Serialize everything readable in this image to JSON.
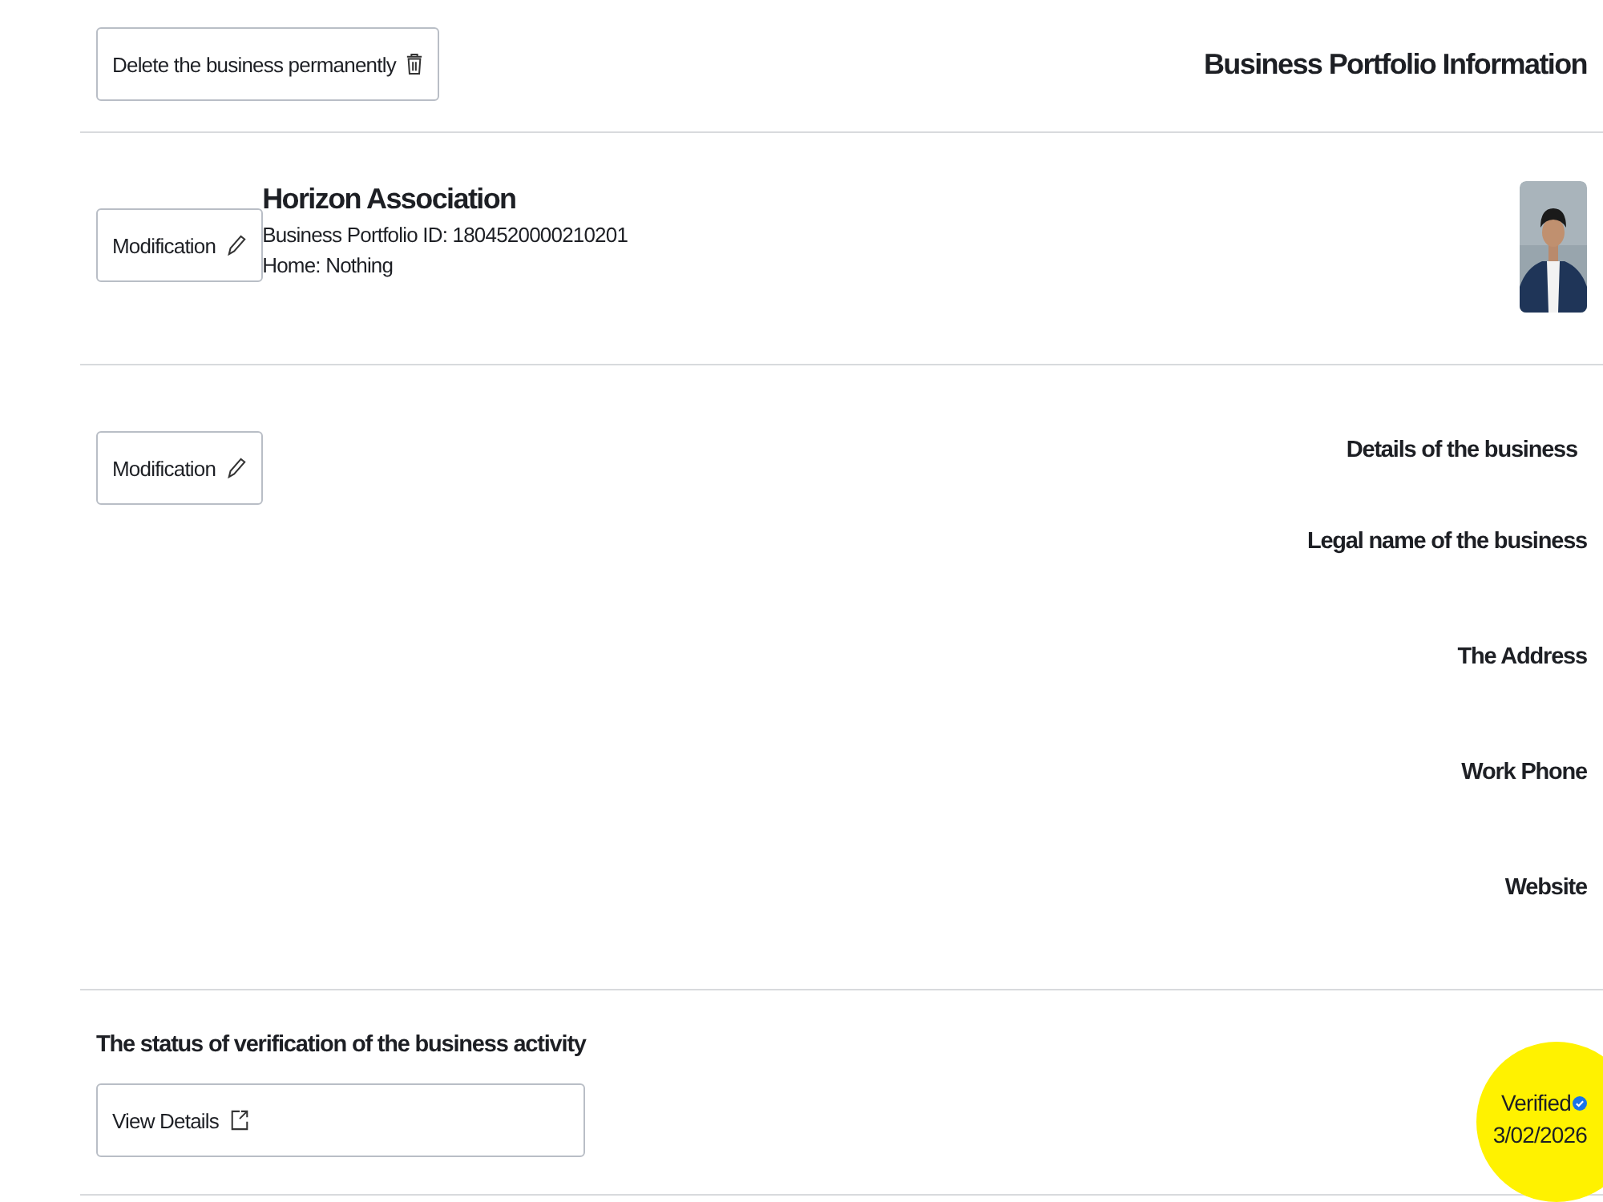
{
  "header": {
    "delete_button": "Delete the business permanently",
    "title": "Business Portfolio Information"
  },
  "profile": {
    "edit_button": "Modification",
    "name": "Horizon Association",
    "portfolio_id": "Business Portfolio ID: 1804520000210201",
    "home": "Home: Nothing"
  },
  "details": {
    "edit_button": "Modification",
    "title": "Details of the business",
    "fields": [
      "Legal name of the business",
      "The Address",
      "Work Phone",
      "Website"
    ]
  },
  "verification": {
    "title": "The status of verification of the business activity",
    "button": "View Details",
    "status": "Verified",
    "verified": true,
    "date": "3/02/2026",
    "highlighted": true
  }
}
